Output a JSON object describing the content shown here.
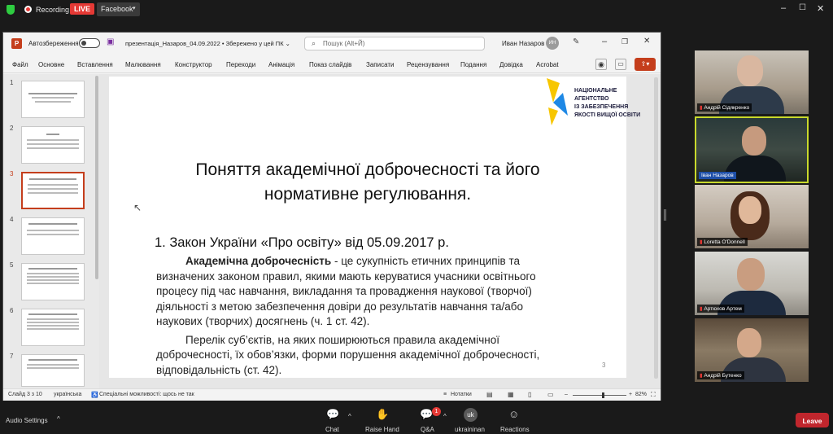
{
  "zoom_top": {
    "recording": "Recording",
    "live": "LIVE",
    "platform": "Facebook"
  },
  "ppt": {
    "autosave_label": "Автозбереження",
    "doc_title": "презентація_Назаров_04.09.2022 • Збережено у цей ПК ⌄",
    "search_placeholder": "Пошук (Alt+Й)",
    "user_name": "Иван Назаров",
    "user_initials": "ИН",
    "menu": [
      "Файл",
      "Основне",
      "Вставлення",
      "Малювання",
      "Конструктор",
      "Переходи",
      "Анімація",
      "Показ слайдів",
      "Записати",
      "Рецензування",
      "Подання",
      "Довідка",
      "Acrobat"
    ],
    "thumb_numbers": [
      "1",
      "2",
      "3",
      "4",
      "5",
      "6",
      "7"
    ],
    "slide": {
      "logo_text_1": "НАЦІОНАЛЬНЕ",
      "logo_text_2": "АГЕНТСТВО",
      "logo_text_3": "ІЗ ЗАБЕЗПЕЧЕННЯ",
      "logo_text_4": "ЯКОСТІ ВИЩОЇ ОСВІТИ",
      "title_1": "Поняття академічної доброчесності та його",
      "title_2": "нормативне регулювання.",
      "heading": "1. Закон України «Про освіту» від 05.09.2017 р.",
      "p1_bold": "Академічна доброчесність",
      "p1_l1": " - це сукупність етичних принципів та",
      "p1_l2": "визначених законом правил, якими мають керуватися учасники освітнього",
      "p1_l3": "процесу під час навчання, викладання та провадження наукової (творчої)",
      "p1_l4": "діяльності з метою забезпечення довіри до результатів навчання та/або",
      "p1_l5": "наукових (творчих) досягнень (ч. 1 ст. 42).",
      "p2_l1": "Перелік суб’єктів, на яких поширюються правила академічної",
      "p2_l2": "доброчесності, їх обов’язки, форми порушення академічної доброчесності,",
      "p2_l3": "відповідальність (ст. 42).",
      "page_number": "3"
    },
    "status": {
      "slide_of": "Слайд 3 з 10",
      "language": "українська",
      "accessibility": "Спеціальні можливості: щось не так",
      "notes": "Нотатки",
      "zoom": "82%"
    }
  },
  "participants": [
    {
      "name": "Андрій Сідякренко"
    },
    {
      "name": "Іван Назаров"
    },
    {
      "name": "Loretta O'Donnell"
    },
    {
      "name": "Артюхов Артем"
    },
    {
      "name": "Андрій Бутенко"
    }
  ],
  "zoom_bottom": {
    "audio_settings": "Audio Settings",
    "chat": "Chat",
    "raise_hand": "Raise Hand",
    "qa": "Q&A",
    "qa_badge": "1",
    "avatar_initials": "uk",
    "username": "ukraininan",
    "reactions": "Reactions",
    "leave": "Leave"
  },
  "colors": {
    "live_red": "#e53935",
    "leave_red": "#c0262d",
    "ppt_accent": "#c43e1c",
    "active_speaker": "#c8d92c"
  }
}
